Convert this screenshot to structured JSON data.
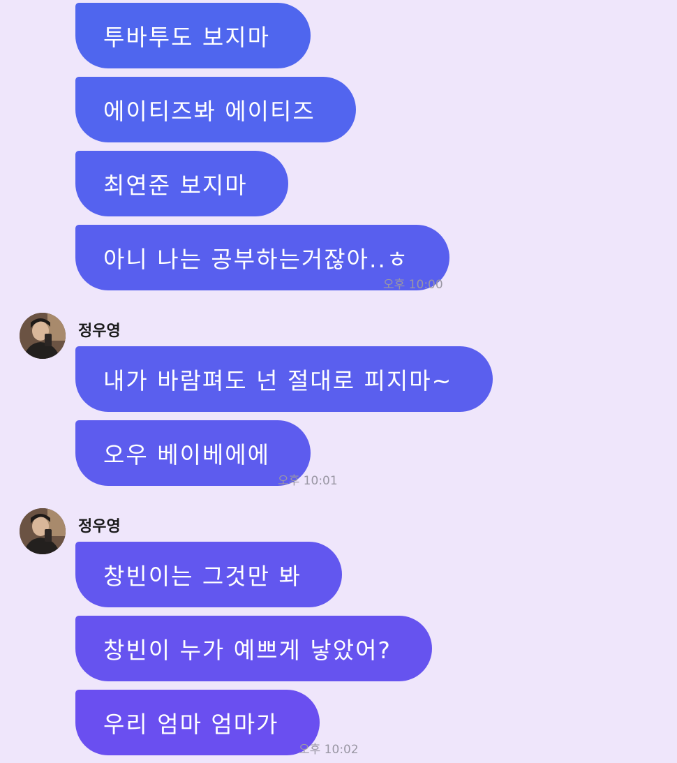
{
  "messages_top": {
    "bubbles": [
      "투바투도 보지마",
      "에이티즈봐 에이티즈",
      "최연준 보지마",
      "아니 나는 공부하는거잖아..ㅎ"
    ],
    "time": "오후 10:00"
  },
  "group1": {
    "sender": "정우영",
    "bubbles": [
      "내가 바람펴도 넌 절대로 피지마~",
      "오우 베이베에에"
    ],
    "time": "오후 10:01"
  },
  "group2": {
    "sender": "정우영",
    "bubbles": [
      "창빈이는 그것만 봐",
      "창빈이 누가 예쁘게 낳았어?",
      "우리 엄마 엄마가"
    ],
    "time": "오후 10:02"
  },
  "colors": {
    "background": "#efe6fb",
    "bubble_top": "#4f66ee",
    "bubble_bottom": "#6a4ff0",
    "timestamp": "#9a97a4"
  },
  "icons": {
    "avatar": "profile-photo"
  }
}
